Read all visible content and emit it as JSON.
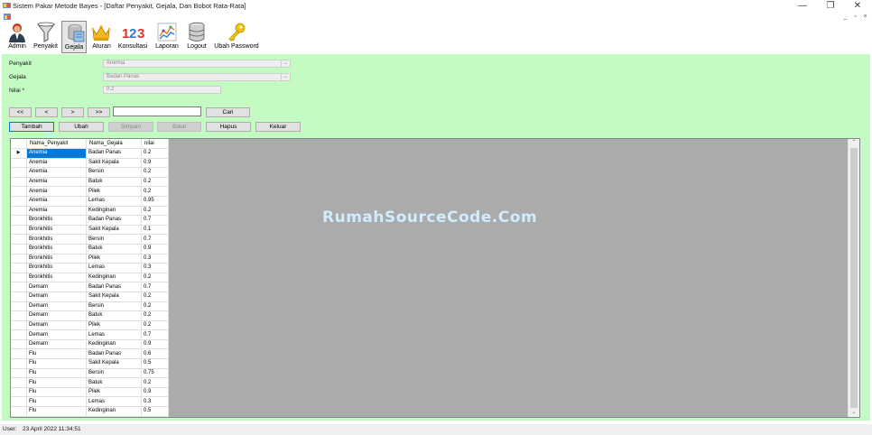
{
  "window": {
    "title": "Sistem Pakar Metode Bayes - [Daftar Penyakit, Gejala, Dan Bobot Rata-Rata]",
    "minimize": "—",
    "maximize": "❐",
    "close": "✕"
  },
  "mdi": {
    "minimize": "_",
    "restore": "▫",
    "close": "×"
  },
  "toolbar": {
    "items": [
      {
        "label": "Admin",
        "icon": "admin-user-icon"
      },
      {
        "label": "Penyakit",
        "icon": "funnel-icon"
      },
      {
        "label": "Gejala",
        "icon": "gejala-icon"
      },
      {
        "label": "Aturan",
        "icon": "crown-icon"
      },
      {
        "label": "Konsultasi",
        "icon": "numbers-123-icon"
      },
      {
        "label": "Laporan",
        "icon": "chart-report-icon"
      },
      {
        "label": "Logout",
        "icon": "database-logout-icon"
      },
      {
        "label": "Ubah Password",
        "icon": "keys-icon"
      }
    ]
  },
  "form": {
    "penyakit_label": "Penyakit",
    "penyakit_value": "Anemia",
    "gejala_label": "Gejala",
    "gejala_value": "Badan Panas",
    "nilai_label": "Nilai *",
    "nilai_value": "0.2",
    "nav": {
      "first": "<<",
      "prev": "<",
      "next": ">",
      "last": ">>"
    },
    "search_value": "",
    "cari": "Cari",
    "tambah": "Tambah",
    "ubah": "Ubah",
    "simpan": "Simpan",
    "batal": "Batal",
    "hapus": "Hapus",
    "keluar": "Keluar"
  },
  "grid": {
    "columns": [
      "Nama_Penyakit",
      "Nama_Gejala",
      "nilai"
    ],
    "current_row_marker": "▶",
    "rows": [
      [
        "Anemia",
        "Badan Panas",
        "0.2"
      ],
      [
        "Anemia",
        "Sakit Kepala",
        "0.9"
      ],
      [
        "Anemia",
        "Bersin",
        "0.2"
      ],
      [
        "Anemia",
        "Batuk",
        "0.2"
      ],
      [
        "Anemia",
        "Pilek",
        "0.2"
      ],
      [
        "Anemia",
        "Lemas",
        "0.95"
      ],
      [
        "Anemia",
        "Kedinginan",
        "0.2"
      ],
      [
        "Bronkhitis",
        "Badan Panas",
        "0.7"
      ],
      [
        "Bronkhitis",
        "Sakit Kepala",
        "0.1"
      ],
      [
        "Bronkhitis",
        "Bersin",
        "0.7"
      ],
      [
        "Bronkhitis",
        "Batuk",
        "0.9"
      ],
      [
        "Bronkhitis",
        "Pilek",
        "0.3"
      ],
      [
        "Bronkhitis",
        "Lemas",
        "0.3"
      ],
      [
        "Bronkhitis",
        "Kedinginan",
        "0.2"
      ],
      [
        "Demam",
        "Badan Panas",
        "0.7"
      ],
      [
        "Demam",
        "Sakit Kepala",
        "0.2"
      ],
      [
        "Demam",
        "Bersin",
        "0.2"
      ],
      [
        "Demam",
        "Batuk",
        "0.2"
      ],
      [
        "Demam",
        "Pilek",
        "0.2"
      ],
      [
        "Demam",
        "Lemas",
        "0.7"
      ],
      [
        "Demam",
        "Kedinginan",
        "0.9"
      ],
      [
        "Flu",
        "Badan Panas",
        "0.6"
      ],
      [
        "Flu",
        "Sakit Kepala",
        "0.5"
      ],
      [
        "Flu",
        "Bersin",
        "0.75"
      ],
      [
        "Flu",
        "Batuk",
        "0.2"
      ],
      [
        "Flu",
        "Pilek",
        "0.9"
      ],
      [
        "Flu",
        "Lemas",
        "0.3"
      ],
      [
        "Flu",
        "Kedinginan",
        "0.5"
      ]
    ]
  },
  "watermark": "RumahSourceCode.Com",
  "status": {
    "user_label": "User:",
    "datetime": "23 April 2022 11:34:51"
  }
}
